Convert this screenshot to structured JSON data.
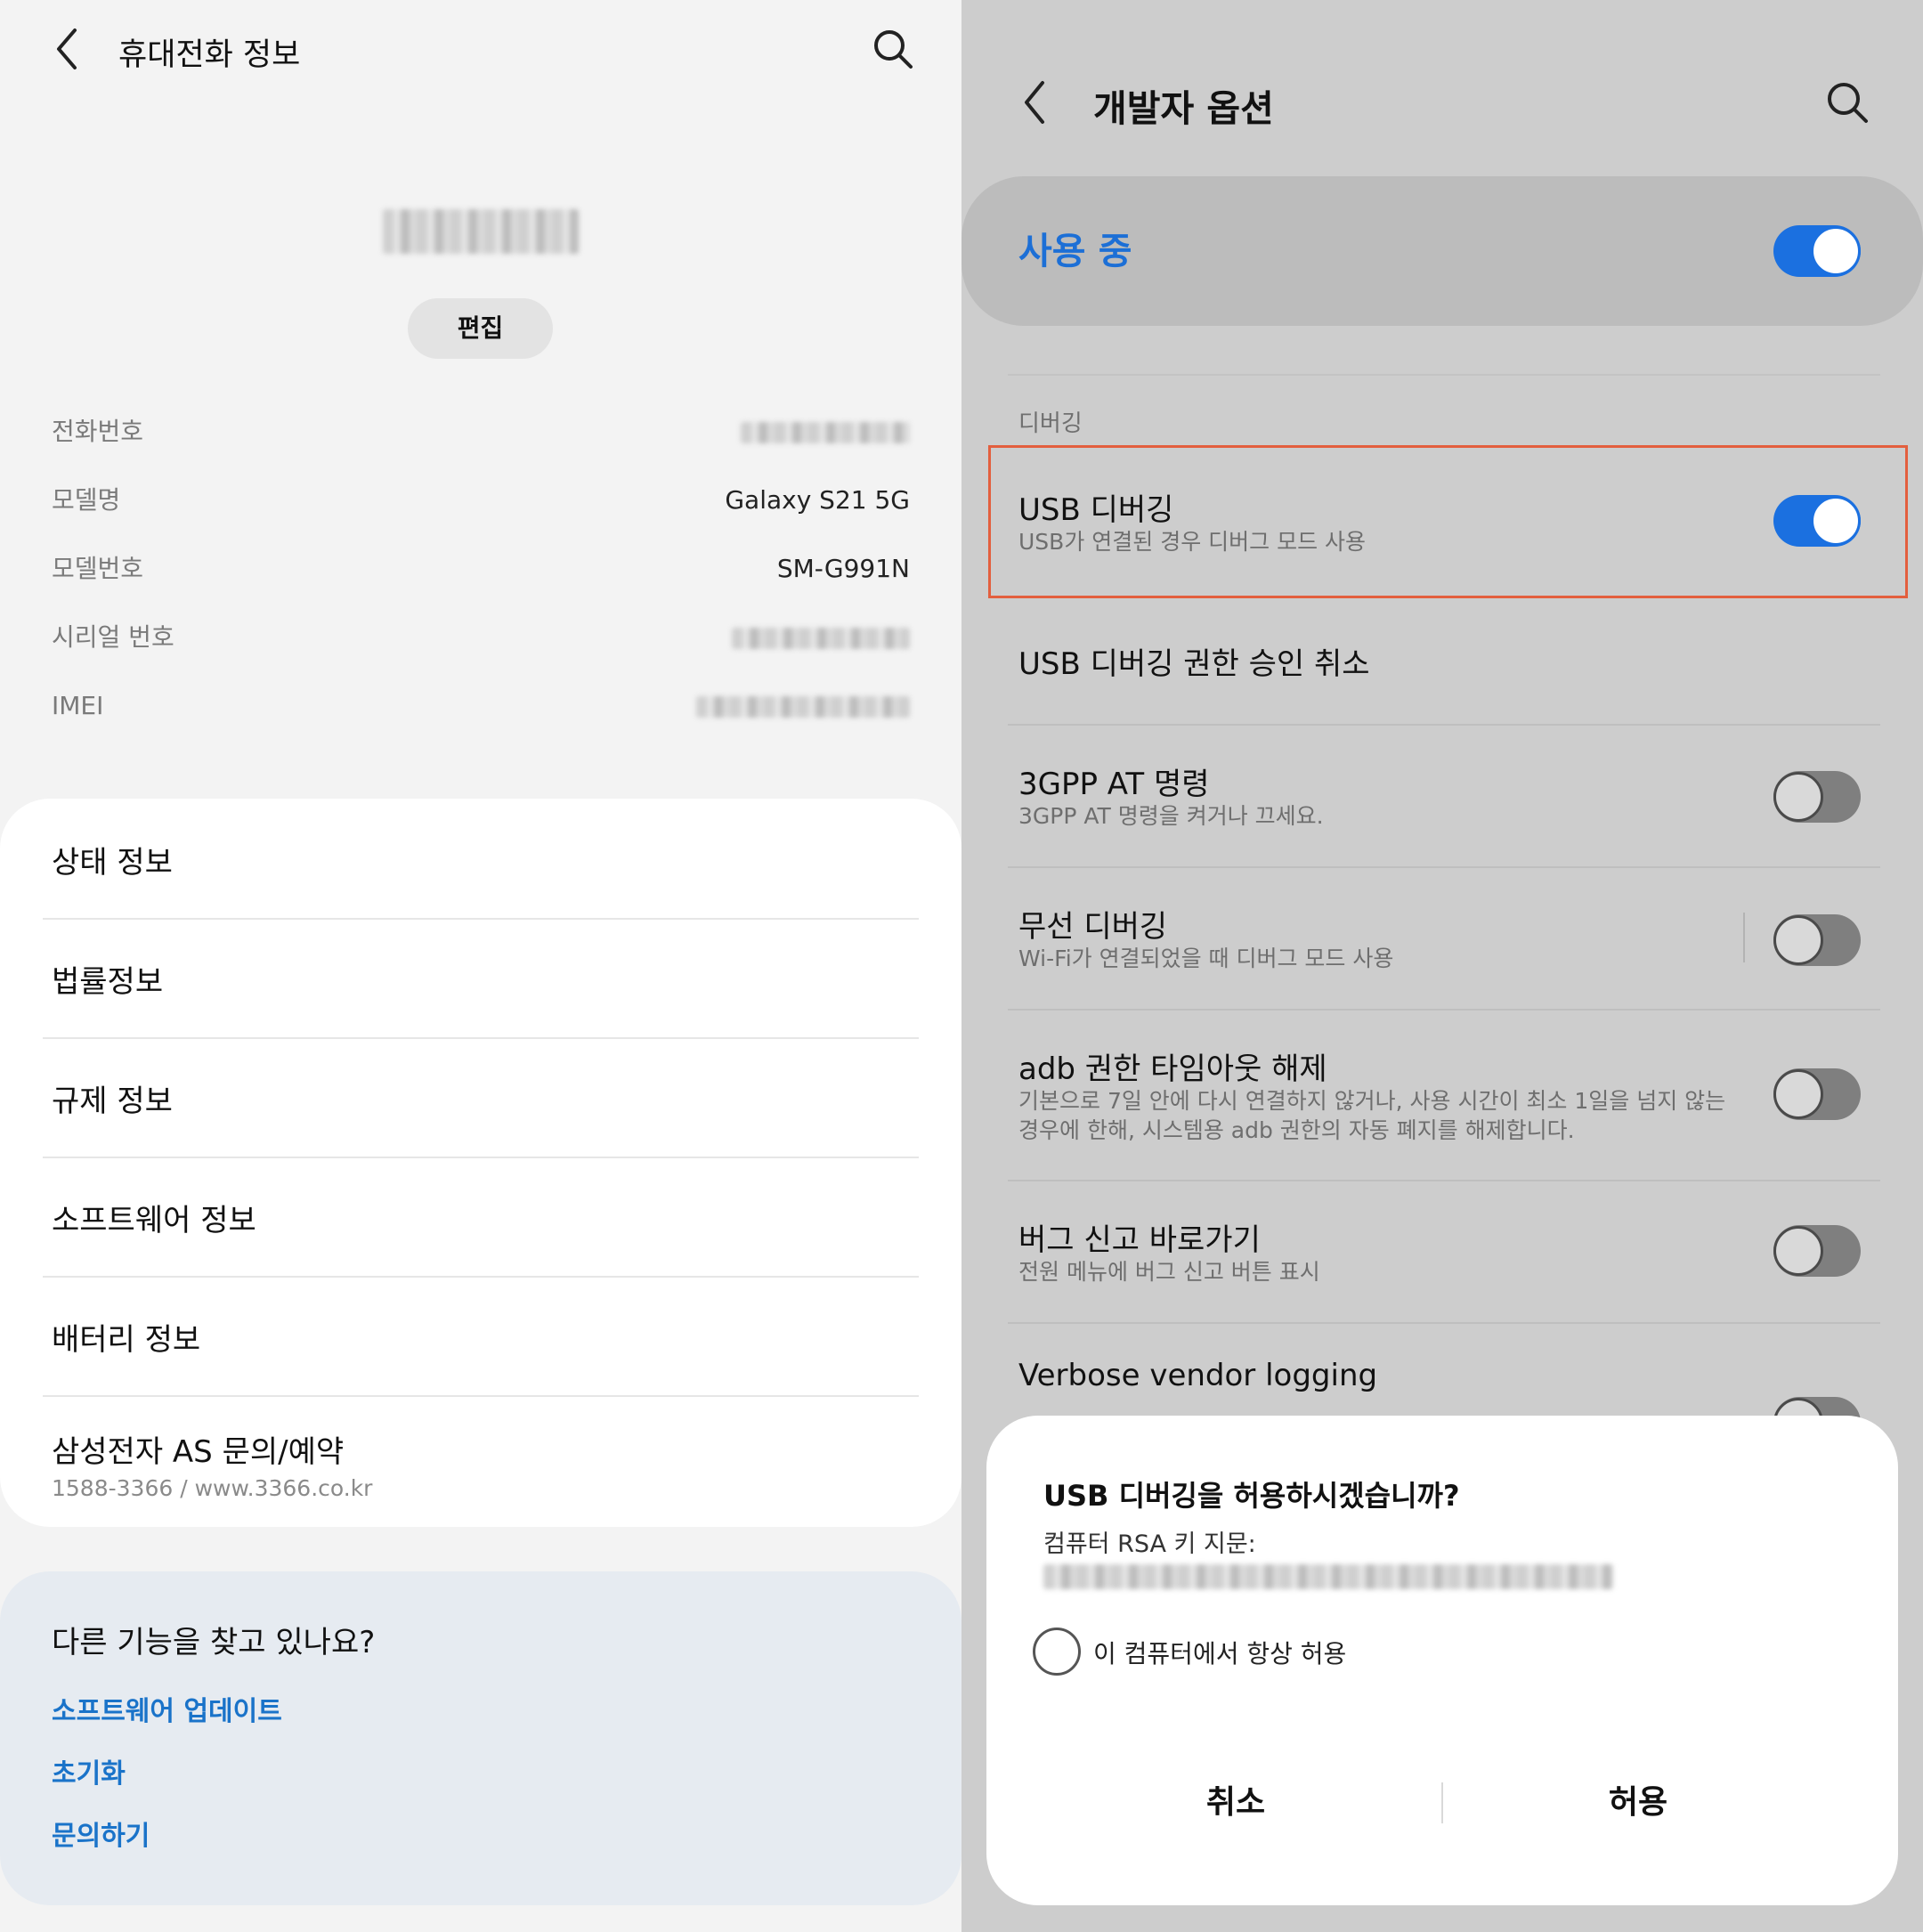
{
  "left": {
    "title": "휴대전화 정보",
    "edit_label": "편집",
    "info_rows": [
      {
        "label": "전화번호",
        "value": ""
      },
      {
        "label": "모델명",
        "value": "Galaxy S21 5G"
      },
      {
        "label": "모델번호",
        "value": "SM-G991N"
      },
      {
        "label": "시리얼 번호",
        "value": ""
      },
      {
        "label": "IMEI",
        "value": ""
      }
    ],
    "menu": [
      {
        "label": "상태 정보"
      },
      {
        "label": "법률정보"
      },
      {
        "label": "규제 정보"
      },
      {
        "label": "소프트웨어 정보"
      },
      {
        "label": "배터리 정보"
      },
      {
        "label": "삼성전자 AS 문의/예약",
        "sub": "1588-3366 / www.3366.co.kr"
      }
    ],
    "help": {
      "title": "다른 기능을 찾고 있나요?",
      "links": [
        "소프트웨어 업데이트",
        "초기화",
        "문의하기"
      ]
    }
  },
  "right": {
    "title": "개발자 옵션",
    "master": {
      "label": "사용 중",
      "on": true
    },
    "section": "디버깅",
    "settings": [
      {
        "title": "USB 디버깅",
        "sub": "USB가 연결된 경우 디버그 모드 사용",
        "toggle": "on"
      },
      {
        "title": "USB 디버깅 권한 승인 취소",
        "sub": "",
        "toggle": "none"
      },
      {
        "title": "3GPP AT 명령",
        "sub": "3GPP AT 명령을 켜거나 끄세요.",
        "toggle": "off"
      },
      {
        "title": "무선 디버깅",
        "sub": "Wi-Fi가 연결되었을 때 디버그 모드 사용",
        "toggle": "off"
      },
      {
        "title": "adb 권한 타임아웃 해제",
        "sub": "기본으로 7일 안에 다시 연결하지 않거나, 사용 시간이 최소 1일을 넘지 않는 경우에 한해, 시스템용 adb 권한의 자동 폐지를 해제합니다.",
        "toggle": "off"
      },
      {
        "title": "버그 신고 바로가기",
        "sub": "전원 메뉴에 버그 신고 버튼 표시",
        "toggle": "off"
      },
      {
        "title": "Verbose vendor logging",
        "sub": "",
        "toggle": "off"
      }
    ],
    "dialog": {
      "title": "USB 디버깅을 허용하시겠습니까?",
      "rsa_label": "컴퓨터 RSA 키 지문:",
      "always_allow": "이 컴퓨터에서 항상 허용",
      "cancel": "취소",
      "allow": "허용"
    }
  },
  "colors": {
    "accent": "#1b70e0",
    "link": "#1a73c9",
    "highlight": "#e35f3e"
  },
  "icons": [
    "back-arrow-icon",
    "search-icon"
  ]
}
